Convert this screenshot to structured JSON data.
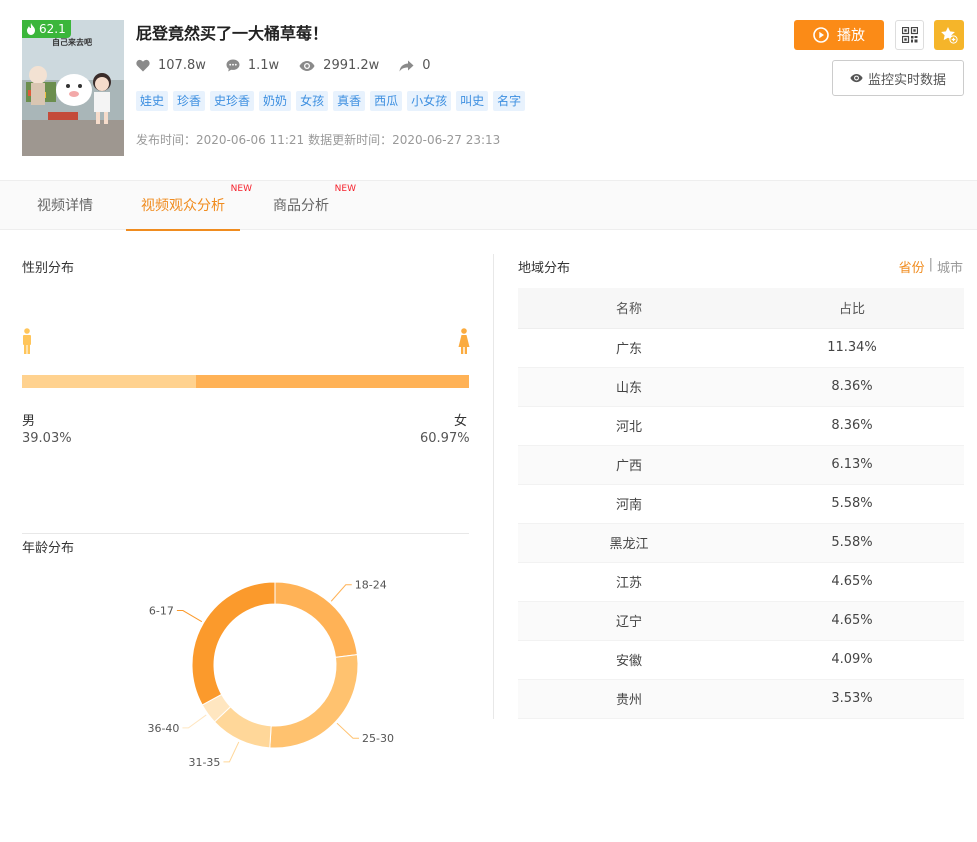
{
  "video": {
    "score": "62.1",
    "thumb_caption": "自己来去吧",
    "title": "屁登竟然买了一大桶草莓！",
    "likes": "107.8w",
    "comments": "1.1w",
    "views": "2991.2w",
    "shares": "0",
    "tags": [
      "娃史",
      "珍香",
      "史珍香",
      "奶奶",
      "女孩",
      "真香",
      "西瓜",
      "小女孩",
      "叫史",
      "名字"
    ],
    "publish_time": "发布时间：2020-06-06 11:21",
    "update_time": "数据更新时间：2020-06-27 23:13"
  },
  "actions": {
    "play_label": "播放",
    "monitor_label": "监控实时数据"
  },
  "tabs": [
    {
      "label": "视频详情",
      "badge": ""
    },
    {
      "label": "视频观众分析",
      "badge": "NEW"
    },
    {
      "label": "商品分析",
      "badge": "NEW"
    }
  ],
  "gender": {
    "title": "性别分布",
    "male_label": "男",
    "female_label": "女",
    "male_pct": "39.03%",
    "female_pct": "60.97%",
    "male_value": 39.03,
    "female_value": 60.97,
    "colors": {
      "male": "#ffd28f",
      "female": "#ffb256",
      "male_icon": "#ffc55a",
      "female_icon": "#fbab3f"
    }
  },
  "age": {
    "title": "年龄分布"
  },
  "region": {
    "title": "地域分布",
    "toggle_province": "省份",
    "toggle_sep": "|",
    "toggle_city": "城市",
    "col_name": "名称",
    "col_share": "占比",
    "rows": [
      {
        "name": "广东",
        "share": "11.34%"
      },
      {
        "name": "山东",
        "share": "8.36%"
      },
      {
        "name": "河北",
        "share": "8.36%"
      },
      {
        "name": "广西",
        "share": "6.13%"
      },
      {
        "name": "河南",
        "share": "5.58%"
      },
      {
        "name": "黑龙江",
        "share": "5.58%"
      },
      {
        "name": "江苏",
        "share": "4.65%"
      },
      {
        "name": "辽宁",
        "share": "4.65%"
      },
      {
        "name": "安徽",
        "share": "4.09%"
      },
      {
        "name": "贵州",
        "share": "3.53%"
      }
    ]
  },
  "chart_data": {
    "type": "pie",
    "title": "年龄分布",
    "categories": [
      "18-24",
      "25-30",
      "31-35",
      "36-40",
      "6-17"
    ],
    "values": [
      23,
      28,
      12,
      4,
      33
    ],
    "colors": [
      "#ffb256",
      "#ffc26f",
      "#ffd799",
      "#ffe6c0",
      "#fb9a2c"
    ]
  },
  "colors": {
    "accent": "#f08c1f",
    "play": "#fb8b17",
    "score_badge": "#3bb63b",
    "tag_bg": "#e8f2fd",
    "tag_text": "#3d8fe0"
  }
}
